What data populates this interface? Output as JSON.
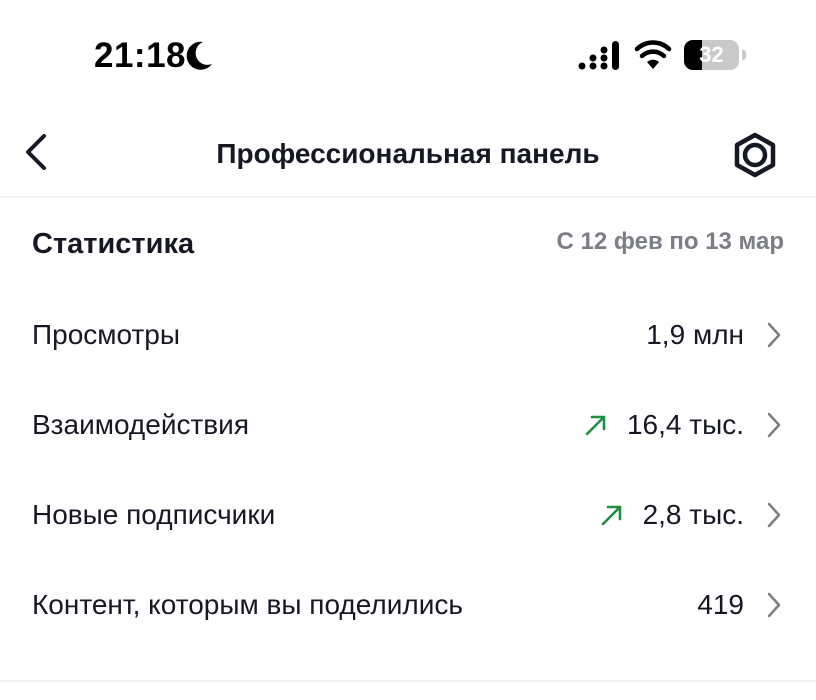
{
  "status_bar": {
    "time": "21:18",
    "battery_percent": 32,
    "battery_label": "32",
    "icons": [
      "moon-icon",
      "signal-icon",
      "wifi-icon",
      "battery-icon"
    ]
  },
  "nav": {
    "title": "Профессиональная панель",
    "back_icon": "chevron-left-icon",
    "settings_icon": "gear-icon"
  },
  "stats": {
    "title": "Статистика",
    "range": "С 12 фев по 13 мар",
    "rows": [
      {
        "label": "Просмотры",
        "value": "1,9 млн",
        "trend": null
      },
      {
        "label": "Взаимодействия",
        "value": "16,4 тыс.",
        "trend": "up"
      },
      {
        "label": "Новые подписчики",
        "value": "2,8 тыс.",
        "trend": "up"
      },
      {
        "label": "Контент, которым вы поделились",
        "value": "419",
        "trend": null
      }
    ]
  },
  "colors": {
    "text": "#161823",
    "muted": "#7c7e85",
    "trend_up": "#1e8f3e",
    "divider": "#f1f1f2"
  }
}
